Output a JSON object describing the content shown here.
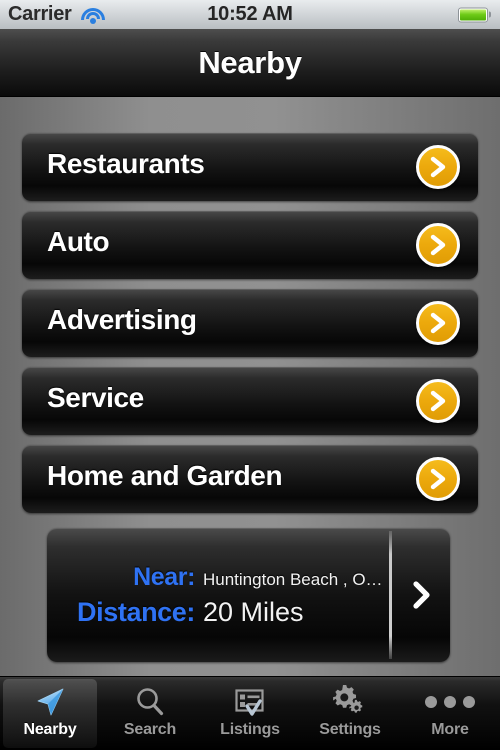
{
  "statusbar": {
    "carrier": "Carrier",
    "wifi_icon": "wifi-icon",
    "time": "10:52 AM",
    "battery_icon": "battery-full-icon"
  },
  "navbar": {
    "title": "Nearby"
  },
  "categories": [
    {
      "label": "Restaurants",
      "chevron_icon": "chevron-right-icon"
    },
    {
      "label": "Auto",
      "chevron_icon": "chevron-right-icon"
    },
    {
      "label": "Advertising",
      "chevron_icon": "chevron-right-icon"
    },
    {
      "label": "Service",
      "chevron_icon": "chevron-right-icon"
    },
    {
      "label": "Home and Garden",
      "chevron_icon": "chevron-right-icon"
    }
  ],
  "near_panel": {
    "near_label": "Near:",
    "near_value": "Huntington Beach , Or…",
    "distance_label": "Distance:",
    "distance_value": "20 Miles",
    "chevron_icon": "chevron-right-icon"
  },
  "tabbar": {
    "items": [
      {
        "label": "Nearby",
        "icon": "navigation-arrow-icon",
        "selected": true
      },
      {
        "label": "Search",
        "icon": "magnifier-icon",
        "selected": false
      },
      {
        "label": "Listings",
        "icon": "list-check-icon",
        "selected": false
      },
      {
        "label": "Settings",
        "icon": "gears-icon",
        "selected": false
      },
      {
        "label": "More",
        "icon": "ellipsis-icon",
        "selected": false
      }
    ]
  },
  "colors": {
    "accent_orange": "#eca90c",
    "accent_blue": "#2f72f3",
    "battery_green": "#6fcb18",
    "wifi_blue": "#2a7fe0"
  }
}
